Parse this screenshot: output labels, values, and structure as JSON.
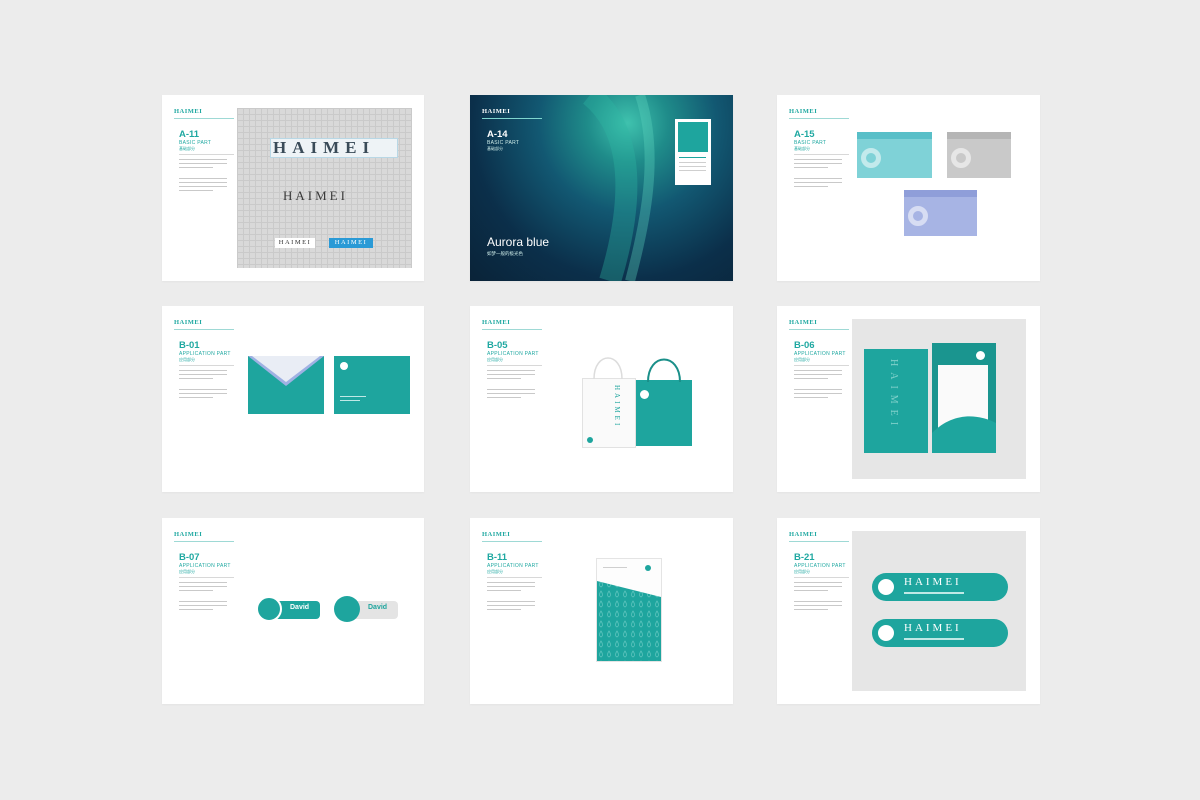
{
  "brand_mark": "HAIMEI",
  "accent_color": "#1ea59e",
  "aurora_colors": {
    "dark": "#0b2f4a",
    "glow": "#27a89b"
  },
  "pages": [
    {
      "code": "A-11",
      "part": "BASIC PART",
      "part_zh": "基础部分",
      "logo_outline": "HAIMEI",
      "logo_wordmark": "HAIMEI",
      "logo_small_dark": "HAIMEI",
      "logo_small_light": "HAIMEI"
    },
    {
      "code": "A-14",
      "part": "BASIC PART",
      "part_zh": "基础部分",
      "headline": "Aurora blue",
      "headline_sub": "如梦一般的极光色"
    },
    {
      "code": "A-15",
      "part": "BASIC PART",
      "part_zh": "基础部分"
    },
    {
      "code": "B-01",
      "part": "APPLICATION PART",
      "part_zh": "应用部分"
    },
    {
      "code": "B-05",
      "part": "APPLICATION PART",
      "part_zh": "应用部分",
      "bag_text": "HAIMEI"
    },
    {
      "code": "B-06",
      "part": "APPLICATION PART",
      "part_zh": "应用部分",
      "folder_text": "HAIMEI"
    },
    {
      "code": "B-07",
      "part": "APPLICATION PART",
      "part_zh": "应用部分",
      "badge_name": "David",
      "badge_name_2": "David"
    },
    {
      "code": "B-11",
      "part": "APPLICATION PART",
      "part_zh": "应用部分"
    },
    {
      "code": "B-21",
      "part": "APPLICATION PART",
      "part_zh": "应用部分",
      "tape_text": "HAIMEI"
    }
  ]
}
